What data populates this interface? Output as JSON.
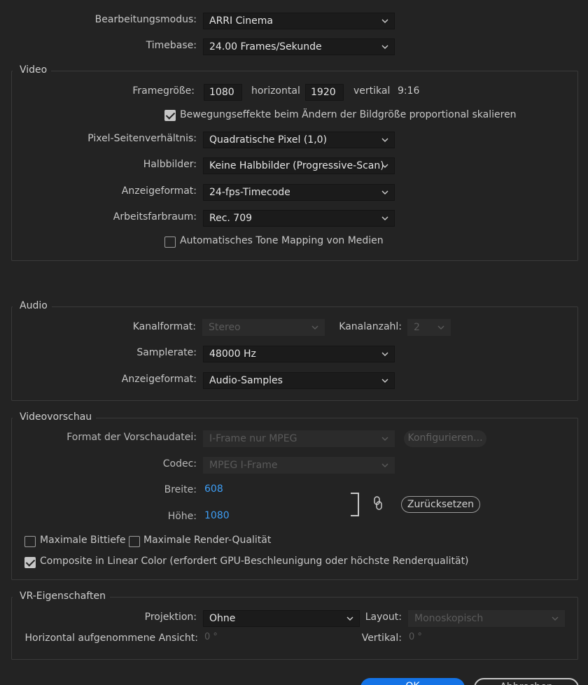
{
  "top": {
    "edit_mode_label": "Bearbeitungsmodus:",
    "edit_mode_value": "ARRI Cinema",
    "timebase_label": "Timebase:",
    "timebase_value": "24.00  Frames/Sekunde"
  },
  "video": {
    "title": "Video",
    "frame_size_label": "Framegröße:",
    "frame_width": "1080",
    "horizontal_label": "horizontal",
    "frame_height": "1920",
    "vertical_label": "vertikal",
    "aspect": "9:16",
    "scale_motion_label": "Bewegungseffekte beim Ändern der Bildgröße proportional skalieren",
    "scale_motion_checked": true,
    "pixel_aspect_label": "Pixel-Seitenverhältnis:",
    "pixel_aspect_value": "Quadratische Pixel (1,0)",
    "fields_label": "Halbbilder:",
    "fields_value": "Keine Halbbilder (Progressive-Scan)",
    "display_format_label": "Anzeigeformat:",
    "display_format_value": "24-fps-Timecode",
    "color_space_label": "Arbeitsfarbraum:",
    "color_space_value": "Rec. 709",
    "tone_mapping_label": "Automatisches Tone Mapping von Medien",
    "tone_mapping_checked": false
  },
  "audio": {
    "title": "Audio",
    "channel_format_label": "Kanalformat:",
    "channel_format_value": "Stereo",
    "channel_count_label": "Kanalanzahl:",
    "channel_count_value": "2",
    "sample_rate_label": "Samplerate:",
    "sample_rate_value": "48000 Hz",
    "display_format_label": "Anzeigeformat:",
    "display_format_value": "Audio-Samples"
  },
  "preview": {
    "title": "Videovorschau",
    "file_format_label": "Format der Vorschaudatei:",
    "file_format_value": "I-Frame nur MPEG",
    "configure_button": "Konfigurieren...",
    "codec_label": "Codec:",
    "codec_value": "MPEG I-Frame",
    "width_label": "Breite:",
    "width_value": "608",
    "height_label": "Höhe:",
    "height_value": "1080",
    "reset_button": "Zurücksetzen",
    "max_bit_depth_label": "Maximale Bittiefe",
    "max_bit_depth_checked": false,
    "max_render_label": "Maximale Render-Qualität",
    "max_render_checked": false,
    "linear_color_label": "Composite in Linear Color (erfordert GPU-Beschleunigung oder höchste Renderqualität)",
    "linear_color_checked": true
  },
  "vr": {
    "title": "VR-Eigenschaften",
    "projection_label": "Projektion:",
    "projection_value": "Ohne",
    "layout_label": "Layout:",
    "layout_value": "Monoskopisch",
    "horizontal_view_label": "Horizontal aufgenommene Ansicht:",
    "horizontal_view_value": "0 °",
    "vertical_label": "Vertikal:",
    "vertical_value": "0 °"
  },
  "footer": {
    "ok_button": "OK",
    "cancel_button": "Abbrechen"
  },
  "colors": {
    "background": "#232323",
    "accent_blue": "#3e9ef5",
    "ok_button": "#1473e6"
  }
}
